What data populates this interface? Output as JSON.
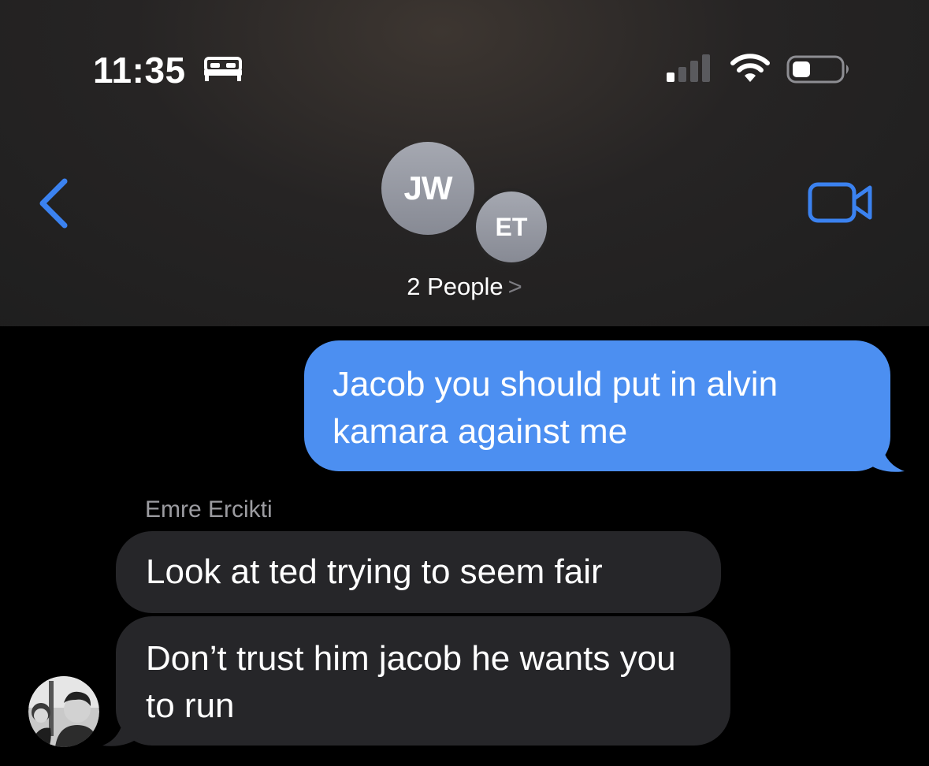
{
  "status_bar": {
    "time": "11:35",
    "focus_icon": "bed-icon",
    "signal_icon": "cellular-signal-icon",
    "wifi_icon": "wifi-icon",
    "battery_icon": "battery-icon"
  },
  "nav": {
    "back_icon": "chevron-left-icon",
    "video_icon": "video-camera-icon",
    "participants": [
      {
        "initials": "JW"
      },
      {
        "initials": "ET"
      }
    ],
    "group_label": "2 People",
    "group_chevron": ">"
  },
  "messages": [
    {
      "direction": "outgoing",
      "text": "Jacob you should put in alvin kamara against me"
    },
    {
      "direction": "incoming",
      "sender": "Emre Ercikti",
      "text": "Look at ted trying to seem fair"
    },
    {
      "direction": "incoming",
      "text": "Don’t trust him jacob he wants you to run"
    }
  ],
  "colors": {
    "accent_blue": "#4c8ff1",
    "incoming_bubble": "#262629",
    "header_bg": "#262525",
    "avatar_gray": "#9799a2"
  }
}
